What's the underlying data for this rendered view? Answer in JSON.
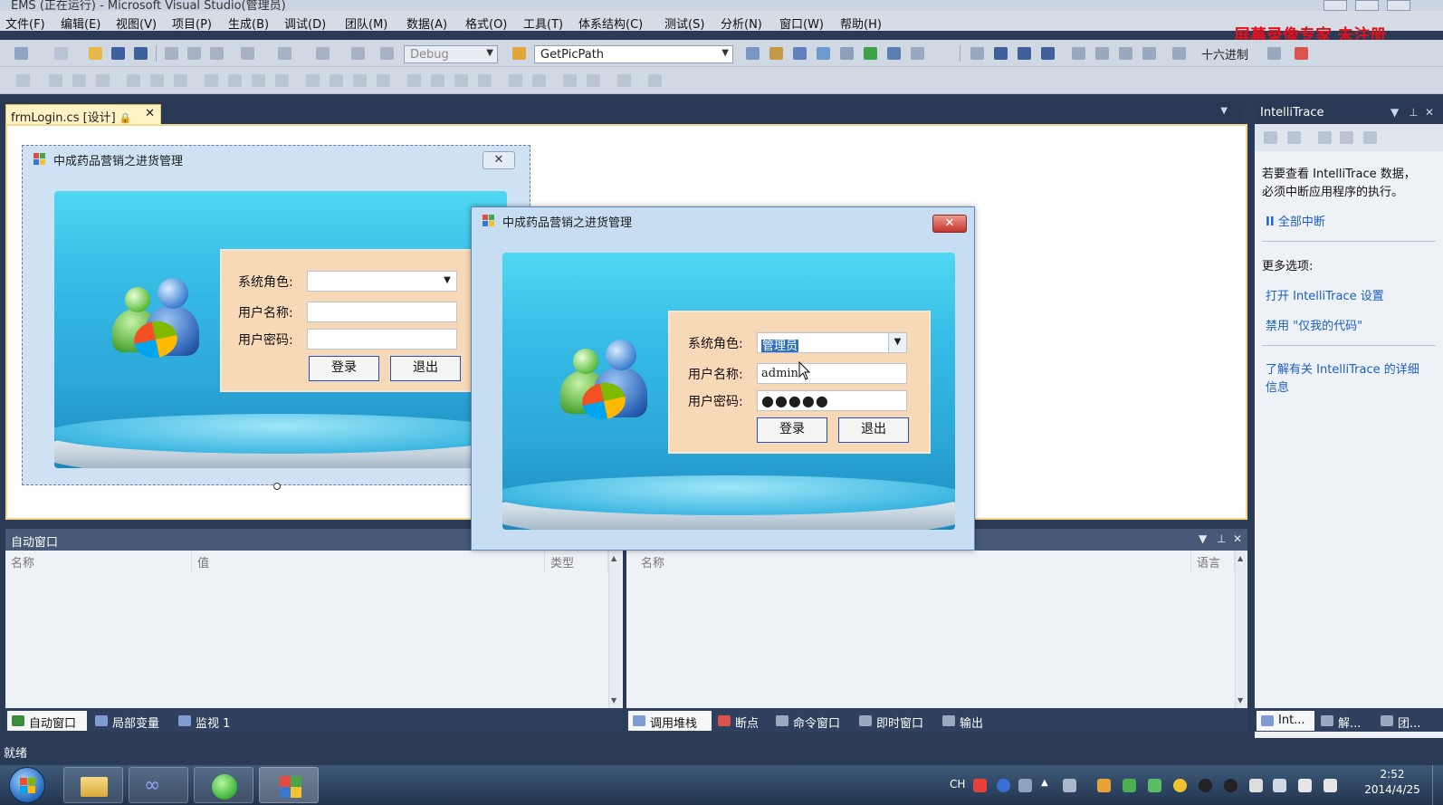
{
  "window": {
    "title": "EMS (正在运行) - Microsoft Visual Studio(管理员)"
  },
  "menu": [
    "文件(F)",
    "编辑(E)",
    "视图(V)",
    "项目(P)",
    "生成(B)",
    "调试(D)",
    "团队(M)",
    "数据(A)",
    "格式(O)",
    "工具(T)",
    "体系结构(C)",
    "测试(S)",
    "分析(N)",
    "窗口(W)",
    "帮助(H)"
  ],
  "watermark": "屏幕录像专家  未注册",
  "toolbar": {
    "config": "Debug",
    "find_combo": "GetPicPath",
    "hex_label": "十六进制"
  },
  "document_tab": {
    "label": "frmLogin.cs [设计]",
    "close": "✕"
  },
  "designer_form": {
    "title": "中成药品营销之进货管理",
    "close": "✕",
    "role_label": "系统角色:",
    "user_label": "用户名称:",
    "pwd_label": "用户密码:",
    "role_value": "",
    "user_value": "",
    "pwd_value": "",
    "login_button": "登录",
    "exit_button": "退出"
  },
  "running_form": {
    "title": "中成药品营销之进货管理",
    "close": "✕",
    "role_label": "系统角色:",
    "user_label": "用户名称:",
    "pwd_label": "用户密码:",
    "role_value": "管理员",
    "user_value": "admin",
    "pwd_value": "●●●●●",
    "login_button": "登录",
    "exit_button": "退出"
  },
  "auto_window": {
    "title": "自动窗口",
    "columns": [
      "名称",
      "值",
      "类型"
    ]
  },
  "call_stack": {
    "columns": [
      "名称",
      "语言"
    ]
  },
  "bottom_tabs_left": [
    "自动窗口",
    "局部变量",
    "监视 1"
  ],
  "bottom_tabs_right": [
    "调用堆栈",
    "断点",
    "命令窗口",
    "即时窗口",
    "输出"
  ],
  "intellitrace": {
    "title": "IntelliTrace",
    "message": [
      "若要查看 IntelliTrace 数据，",
      "必须中断应用程序的执行。"
    ],
    "break_all": "全部中断",
    "more_options": "更多选项:",
    "open_settings": "打开 IntelliTrace 设置",
    "disable_my_code": "禁用 \"仅我的代码\"",
    "learn_more": [
      "了解有关 IntelliTrace 的详细",
      "信息"
    ],
    "tabs": [
      "Int...",
      "解...",
      "团..."
    ]
  },
  "status": "就绪",
  "taskbar": {
    "tray": {
      "lang": "CH",
      "time": "2:52",
      "date": "2014/4/25"
    }
  },
  "colors": {
    "vs_chrome": "#2b3a55",
    "doc_tab": "#fff3c5",
    "form_panel": "#f8d9b7",
    "button_border": "#2850b8",
    "link": "#1a5fc5",
    "watermark": "#e3101c"
  },
  "icons": [
    "windows-start-icon",
    "explorer-folder-icon",
    "visual-studio-icon",
    "refresh-app-icon",
    "ems-app-icon"
  ]
}
